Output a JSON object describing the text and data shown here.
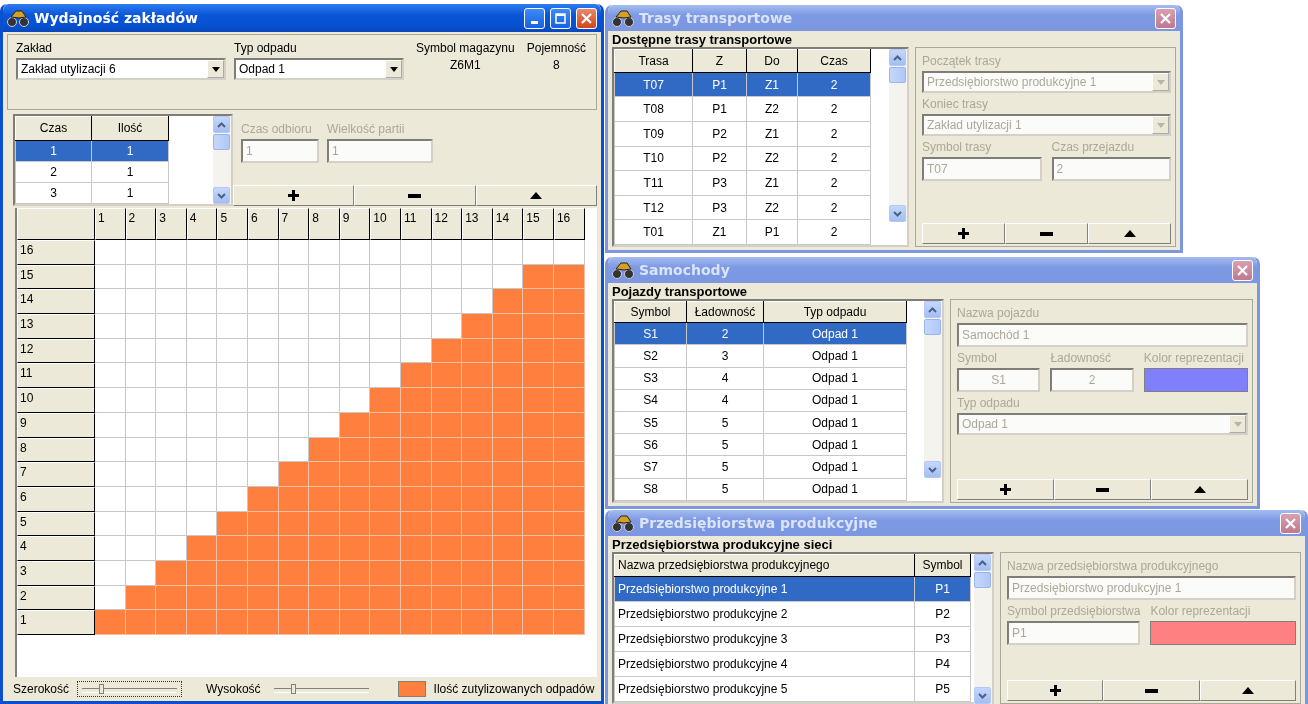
{
  "capacity_window": {
    "title": "Wydajność zakładów",
    "active": true,
    "plant": {
      "label": "Zakład",
      "value": "Zakład utylizacji 6"
    },
    "waste": {
      "label": "Typ odpadu",
      "value": "Odpad 1"
    },
    "store_symbol": {
      "label": "Symbol magazynu",
      "value": "Z6M1"
    },
    "capacity": {
      "label": "Pojemność",
      "value": "8"
    },
    "batch_table": {
      "columns": [
        "Czas",
        "Ilość"
      ],
      "rows": [
        {
          "cells": [
            "1",
            "1"
          ],
          "selected": true
        },
        {
          "cells": [
            "2",
            "1"
          ],
          "selected": false
        },
        {
          "cells": [
            "3",
            "1"
          ],
          "selected": false
        }
      ]
    },
    "form_disabled": true,
    "pickup_time": {
      "label": "Czas odbioru",
      "value": "1"
    },
    "batch_size": {
      "label": "Wielkość partii",
      "value": "1"
    },
    "grid": {
      "columns": [
        "1",
        "2",
        "3",
        "4",
        "5",
        "6",
        "7",
        "8",
        "9",
        "10",
        "11",
        "12",
        "13",
        "14",
        "15",
        "16"
      ],
      "rows": [
        {
          "label": "16",
          "cells": [
            false,
            false,
            false,
            false,
            false,
            false,
            false,
            false,
            false,
            false,
            false,
            false,
            false,
            false,
            false,
            false
          ]
        },
        {
          "label": "15",
          "cells": [
            false,
            false,
            false,
            false,
            false,
            false,
            false,
            false,
            false,
            false,
            false,
            false,
            false,
            false,
            true,
            true
          ]
        },
        {
          "label": "14",
          "cells": [
            false,
            false,
            false,
            false,
            false,
            false,
            false,
            false,
            false,
            false,
            false,
            false,
            false,
            true,
            true,
            true
          ]
        },
        {
          "label": "13",
          "cells": [
            false,
            false,
            false,
            false,
            false,
            false,
            false,
            false,
            false,
            false,
            false,
            false,
            true,
            true,
            true,
            true
          ]
        },
        {
          "label": "12",
          "cells": [
            false,
            false,
            false,
            false,
            false,
            false,
            false,
            false,
            false,
            false,
            false,
            true,
            true,
            true,
            true,
            true
          ]
        },
        {
          "label": "11",
          "cells": [
            false,
            false,
            false,
            false,
            false,
            false,
            false,
            false,
            false,
            false,
            true,
            true,
            true,
            true,
            true,
            true
          ]
        },
        {
          "label": "10",
          "cells": [
            false,
            false,
            false,
            false,
            false,
            false,
            false,
            false,
            false,
            true,
            true,
            true,
            true,
            true,
            true,
            true
          ]
        },
        {
          "label": "9",
          "cells": [
            false,
            false,
            false,
            false,
            false,
            false,
            false,
            false,
            true,
            true,
            true,
            true,
            true,
            true,
            true,
            true
          ]
        },
        {
          "label": "8",
          "cells": [
            false,
            false,
            false,
            false,
            false,
            false,
            false,
            true,
            true,
            true,
            true,
            true,
            true,
            true,
            true,
            true
          ]
        },
        {
          "label": "7",
          "cells": [
            false,
            false,
            false,
            false,
            false,
            false,
            true,
            true,
            true,
            true,
            true,
            true,
            true,
            true,
            true,
            true
          ]
        },
        {
          "label": "6",
          "cells": [
            false,
            false,
            false,
            false,
            false,
            true,
            true,
            true,
            true,
            true,
            true,
            true,
            true,
            true,
            true,
            true
          ]
        },
        {
          "label": "5",
          "cells": [
            false,
            false,
            false,
            false,
            true,
            true,
            true,
            true,
            true,
            true,
            true,
            true,
            true,
            true,
            true,
            true
          ]
        },
        {
          "label": "4",
          "cells": [
            false,
            false,
            false,
            true,
            true,
            true,
            true,
            true,
            true,
            true,
            true,
            true,
            true,
            true,
            true,
            true
          ]
        },
        {
          "label": "3",
          "cells": [
            false,
            false,
            true,
            true,
            true,
            true,
            true,
            true,
            true,
            true,
            true,
            true,
            true,
            true,
            true,
            true
          ]
        },
        {
          "label": "2",
          "cells": [
            false,
            true,
            true,
            true,
            true,
            true,
            true,
            true,
            true,
            true,
            true,
            true,
            true,
            true,
            true,
            true
          ]
        },
        {
          "label": "1",
          "cells": [
            true,
            true,
            true,
            true,
            true,
            true,
            true,
            true,
            true,
            true,
            true,
            true,
            true,
            true,
            true,
            true
          ]
        }
      ]
    },
    "width_slider": {
      "label": "Szerokość",
      "level": 0.2
    },
    "height_slider": {
      "label": "Wysokość",
      "level": 0.2
    },
    "legend": {
      "label": "Ilość zutylizowanych odpadów",
      "color": "#ff7f3f"
    }
  },
  "side_windows": [
    {
      "title": "Trasy transportowe",
      "active": false,
      "section_title": "Dostępne trasy transportowe",
      "table": {
        "columns": [
          "Trasa",
          "Z",
          "Do",
          "Czas"
        ],
        "rows": [
          {
            "cells": [
              "T07",
              "P1",
              "Z1",
              "2"
            ],
            "selected": true
          },
          {
            "cells": [
              "T08",
              "P1",
              "Z2",
              "2"
            ],
            "selected": false
          },
          {
            "cells": [
              "T09",
              "P2",
              "Z1",
              "2"
            ],
            "selected": false
          },
          {
            "cells": [
              "T10",
              "P2",
              "Z2",
              "2"
            ],
            "selected": false
          },
          {
            "cells": [
              "T11",
              "P3",
              "Z1",
              "2"
            ],
            "selected": false
          },
          {
            "cells": [
              "T12",
              "P3",
              "Z2",
              "2"
            ],
            "selected": false
          },
          {
            "cells": [
              "T01",
              "Z1",
              "P1",
              "2"
            ],
            "selected": false
          }
        ]
      },
      "form_disabled": true,
      "form_rows": [
        [
          {
            "kind": "combo",
            "label": "Początek trasy",
            "value": "Przedsiębiorstwo produkcyjne 1"
          }
        ],
        [
          {
            "kind": "combo",
            "label": "Koniec trasy",
            "value": "Zakład utylizacji 1"
          }
        ],
        [
          {
            "kind": "text",
            "label": "Symbol trasy",
            "value": "T07"
          },
          {
            "kind": "text",
            "label": "Czas przejazdu",
            "value": "2"
          }
        ]
      ]
    },
    {
      "title": "Samochody",
      "active": false,
      "section_title": "Pojazdy transportowe",
      "table": {
        "columns": [
          "Symbol",
          "Ładowność",
          "Typ odpadu"
        ],
        "rows": [
          {
            "cells": [
              "S1",
              "2",
              "Odpad 1"
            ],
            "selected": true
          },
          {
            "cells": [
              "S2",
              "3",
              "Odpad 1"
            ],
            "selected": false
          },
          {
            "cells": [
              "S3",
              "4",
              "Odpad 1"
            ],
            "selected": false
          },
          {
            "cells": [
              "S4",
              "4",
              "Odpad 1"
            ],
            "selected": false
          },
          {
            "cells": [
              "S5",
              "5",
              "Odpad 1"
            ],
            "selected": false
          },
          {
            "cells": [
              "S6",
              "5",
              "Odpad 1"
            ],
            "selected": false
          },
          {
            "cells": [
              "S7",
              "5",
              "Odpad 1"
            ],
            "selected": false
          },
          {
            "cells": [
              "S8",
              "5",
              "Odpad 1"
            ],
            "selected": false
          }
        ]
      },
      "form_disabled": true,
      "form_rows": [
        [
          {
            "kind": "text",
            "label": "Nazwa pojazdu",
            "value": "Samochód 1"
          }
        ],
        [
          {
            "kind": "centered",
            "label": "Symbol",
            "value": "S1"
          },
          {
            "kind": "centered",
            "label": "Ładowność",
            "value": "2"
          },
          {
            "kind": "color",
            "label": "Kolor reprezentacji",
            "color": "#8080ff"
          }
        ],
        [
          {
            "kind": "combo",
            "label": "Typ odpadu",
            "value": "Odpad 1"
          }
        ]
      ]
    },
    {
      "title": "Przedsiębiorstwa produkcyjne",
      "active": false,
      "section_title": "Przedsiębiorstwa produkcyjne sieci",
      "table": {
        "columns": [
          "Nazwa przedsiębiorstwa produkcyjnego",
          "Symbol"
        ],
        "rows": [
          {
            "cells": [
              "Przedsiębiorstwo produkcyjne 1",
              "P1"
            ],
            "selected": true
          },
          {
            "cells": [
              "Przedsiębiorstwo produkcyjne 2",
              "P2"
            ],
            "selected": false
          },
          {
            "cells": [
              "Przedsiębiorstwo produkcyjne 3",
              "P3"
            ],
            "selected": false
          },
          {
            "cells": [
              "Przedsiębiorstwo produkcyjne 4",
              "P4"
            ],
            "selected": false
          },
          {
            "cells": [
              "Przedsiębiorstwo produkcyjne 5",
              "P5"
            ],
            "selected": false
          }
        ]
      },
      "form_disabled": true,
      "form_rows": [
        [
          {
            "kind": "text",
            "label": "Nazwa przedsiębiorstwa produkcyjnego",
            "value": "Przedsiębiorstwo produkcyjne 1"
          }
        ],
        [
          {
            "kind": "text",
            "label": "Symbol przedsiębiorstwa",
            "value": "P1"
          },
          {
            "kind": "color",
            "label": "Kolor reprezentacji",
            "color": "#ff8080"
          }
        ]
      ]
    }
  ]
}
